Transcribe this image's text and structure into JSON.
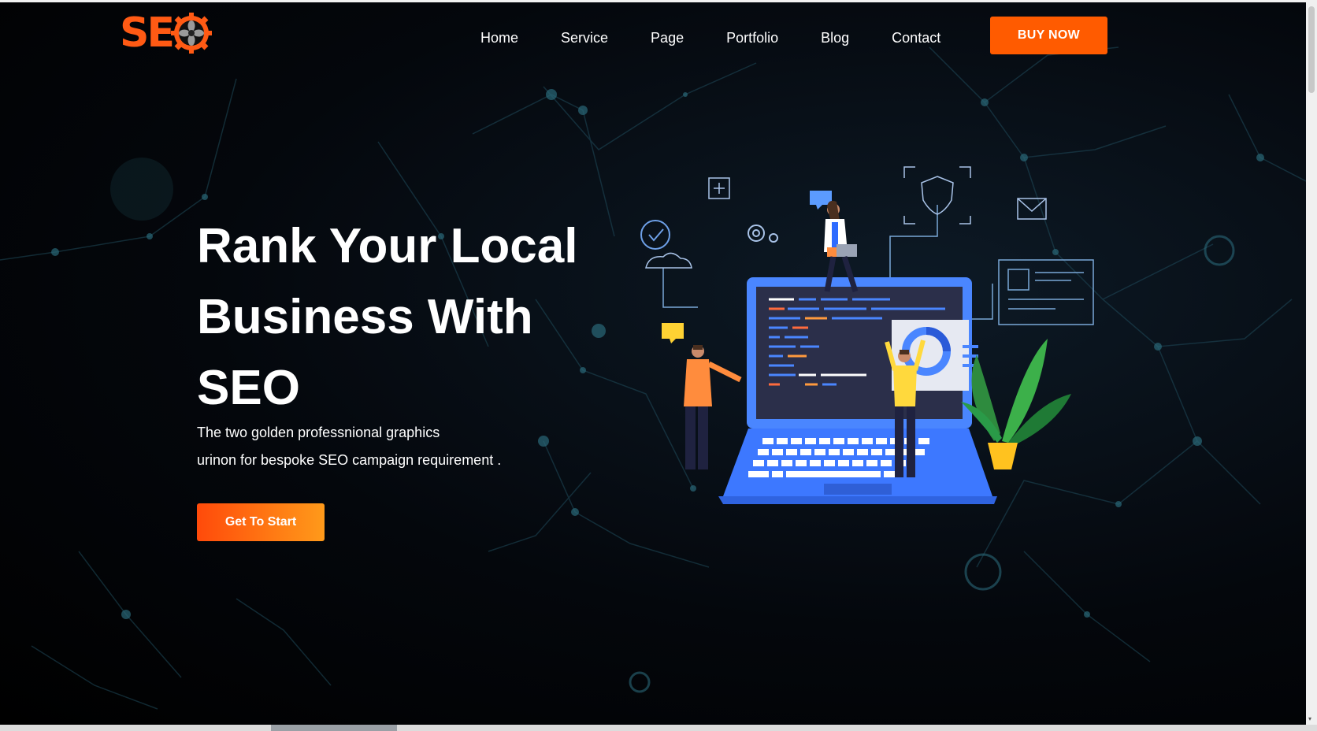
{
  "logo": {
    "text": "SE",
    "icon": "gear-icon",
    "color": "#ff5a14"
  },
  "nav": {
    "items": [
      {
        "label": "Home"
      },
      {
        "label": "Service"
      },
      {
        "label": "Page"
      },
      {
        "label": "Portfolio"
      },
      {
        "label": "Blog"
      },
      {
        "label": "Contact"
      }
    ],
    "buy_label": "BUY NOW"
  },
  "hero": {
    "title_lines": [
      "Rank Your Local",
      "Business With",
      "SEO"
    ],
    "subtitle_lines": [
      "The two golden professnional graphics",
      "urinon for bespoke SEO campaign requirement ."
    ],
    "cta_label": "Get To Start"
  },
  "illustration": {
    "icons": [
      "plus-box-icon",
      "check-circle-icon",
      "gear-icon",
      "chat-bubble-icon",
      "cloud-icon",
      "shield-icon",
      "mail-icon",
      "browser-window-icon",
      "donut-chart-icon",
      "plant-icon"
    ]
  },
  "colors": {
    "accent": "#ff5b00",
    "laptop": "#3d7bff",
    "background": "#04070c"
  }
}
